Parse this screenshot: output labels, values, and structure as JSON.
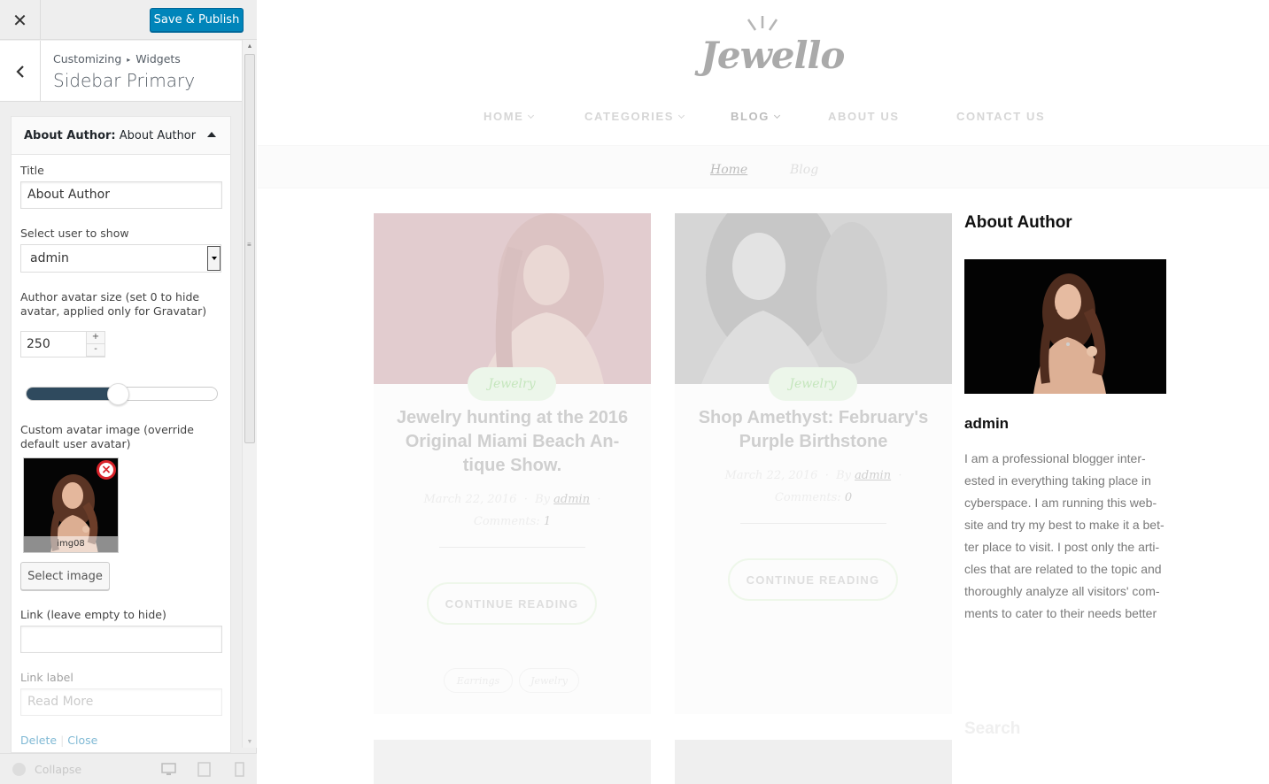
{
  "customizer": {
    "close_icon": "close-icon",
    "save_label": "Save & Publish",
    "breadcrumb": {
      "root": "Customizing",
      "current": "Widgets"
    },
    "panel_title": "Sidebar Primary",
    "widget": {
      "header_bold": "About Author:",
      "header_name": "About Author",
      "title_label": "Title",
      "title_value": "About Author",
      "user_label": "Select user to show",
      "user_value": "admin",
      "avatar_size_label": "Author avatar size (set 0 to hide avatar, applied only for Gravatar)",
      "avatar_size_value": "250",
      "spin_up": "+",
      "spin_down": "-",
      "slider_fraction": 0.48,
      "custom_avatar_label": "Custom avatar image (override default user avatar)",
      "custom_avatar_caption": "img08",
      "select_image_label": "Select image",
      "link_label": "Link (leave empty to hide)",
      "link_value": "",
      "link_label_label": "Link label",
      "link_label_placeholder": "Read More",
      "delete_label": "Delete",
      "close_label": "Close"
    },
    "footer": {
      "collapse_label": "Collapse"
    },
    "colors": {
      "accent": "#0085ba",
      "slider": "#2f4a5e"
    }
  },
  "preview": {
    "logo": "Jewello",
    "nav": [
      {
        "label": "HOME",
        "dropdown": true,
        "active": false
      },
      {
        "label": "CATEGORIES",
        "dropdown": true,
        "active": false
      },
      {
        "label": "BLOG",
        "dropdown": true,
        "active": true
      },
      {
        "label": "ABOUT US",
        "dropdown": false,
        "active": false
      },
      {
        "label": "CONTACT US",
        "dropdown": false,
        "active": false
      }
    ],
    "breadcrumb": {
      "home": "Home",
      "current": "Blog"
    },
    "posts": [
      {
        "category": "Jewelry",
        "title": "Jewelry hunting at the 2016 Original Miami Beach An-tique Show.",
        "date": "March 22, 2016",
        "by": "By",
        "author": "admin",
        "comments_label": "Comments:",
        "comments": "1",
        "button": "CONTINUE READING",
        "tags": [
          "Earrings",
          "Jewelry"
        ]
      },
      {
        "category": "Jewelry",
        "title": "Shop Amethyst: February's Purple Birthstone",
        "date": "March 22, 2016",
        "by": "By",
        "author": "admin",
        "comments_label": "Comments:",
        "comments": "0",
        "button": "CONTINUE READING"
      }
    ],
    "sidebar": {
      "widget_title": "About Author",
      "author_name": "admin",
      "bio": "I am a professional blogger inter-ested in everything taking place in cyberspace. I am running this web-site and try my best to make it a bet-ter place to visit. I post only the arti-cles that are related to the topic and thoroughly analyze all visitors' com-ments to cater to their needs better",
      "next_widget": "Search"
    }
  }
}
